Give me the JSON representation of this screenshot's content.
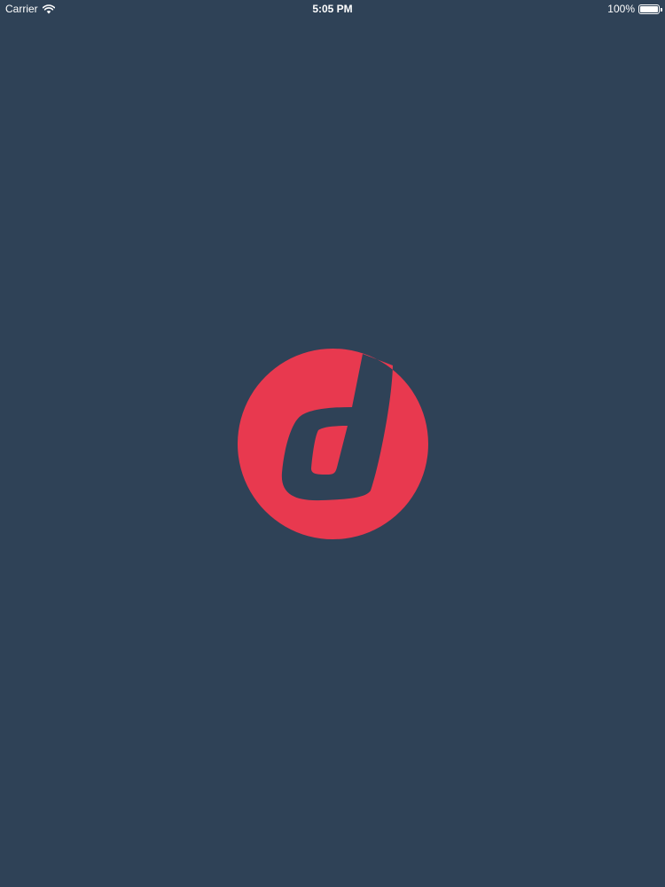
{
  "status_bar": {
    "carrier": "Carrier",
    "time": "5:05 PM",
    "battery_text": "100%",
    "battery_level": 1.0,
    "wifi_icon": "wifi-icon",
    "battery_icon": "battery-icon"
  },
  "splash": {
    "logo_icon": "brand-d-logo-icon",
    "logo_color": "#e8394f"
  },
  "colors": {
    "background": "#2f4257",
    "status_text": "#ffffff"
  }
}
